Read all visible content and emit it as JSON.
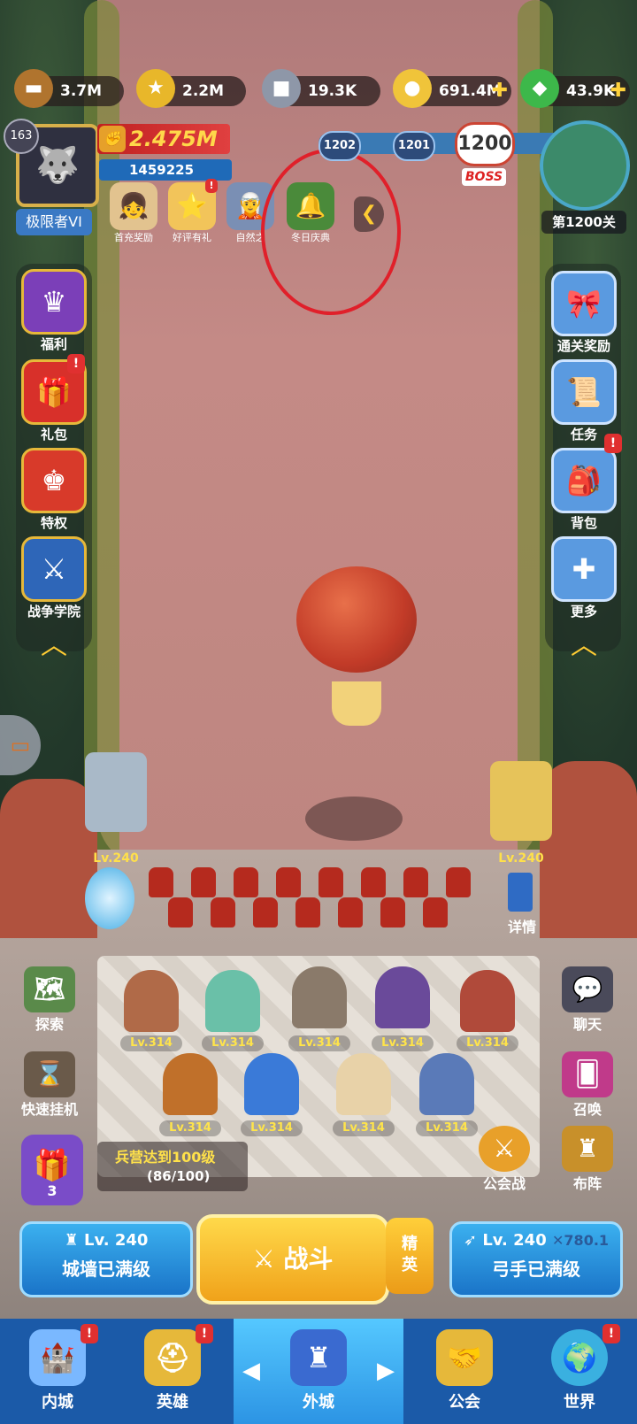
{
  "resources": [
    {
      "name": "wood",
      "icon": "wood-log-icon",
      "value": "3.7M",
      "has_plus": false
    },
    {
      "name": "medal",
      "icon": "star-medal-icon",
      "value": "2.2M",
      "has_plus": false
    },
    {
      "name": "iron",
      "icon": "iron-ingot-icon",
      "value": "19.3K",
      "has_plus": false
    },
    {
      "name": "gold",
      "icon": "gold-coin-icon",
      "value": "691.4M",
      "has_plus": true
    },
    {
      "name": "gem",
      "icon": "green-gem-icon",
      "value": "43.9K",
      "has_plus": true
    }
  ],
  "player": {
    "level": "163",
    "power": "2.475M",
    "id": "1459225",
    "rank": "极限者VI"
  },
  "events": [
    {
      "label": "首充奖励",
      "icon": "girl-portrait-icon"
    },
    {
      "label": "好评有礼",
      "icon": "star-card-icon",
      "badge": "!"
    },
    {
      "label": "自然之",
      "icon": "hero-portrait-icon"
    },
    {
      "label": "冬日庆典",
      "icon": "christmas-bell-icon"
    }
  ],
  "stages": {
    "prev2": "1202",
    "prev1": "1201",
    "current": "1200",
    "boss_label": "BOSS",
    "map_label": "第1200关"
  },
  "left_menu": [
    {
      "label": "福利",
      "icon": "crown-badge-icon",
      "badge": ""
    },
    {
      "label": "礼包",
      "icon": "gift-box-icon",
      "badge": "!"
    },
    {
      "label": "特权",
      "icon": "crown-shield-icon",
      "badge": ""
    },
    {
      "label": "战争学院",
      "icon": "crossed-swords-shield-icon",
      "badge": ""
    }
  ],
  "right_menu": [
    {
      "label": "通关奖励",
      "icon": "gift-icon",
      "badge": ""
    },
    {
      "label": "任务",
      "icon": "task-scroll-icon",
      "badge": "!"
    },
    {
      "label": "背包",
      "icon": "backpack-icon",
      "badge": ""
    },
    {
      "label": "更多",
      "icon": "plus-dpad-icon",
      "badge": ""
    }
  ],
  "towers": {
    "left_level": "Lv.240",
    "right_level": "Lv.240",
    "detail_label": "详情"
  },
  "heroes_row1": [
    "Lv.314",
    "Lv.314",
    "Lv.314",
    "Lv.314",
    "Lv.314"
  ],
  "heroes_row2": [
    "Lv.314",
    "Lv.314",
    "Lv.314",
    "Lv.314"
  ],
  "side_actions_left": [
    {
      "label": "探索",
      "icon": "map-sword-icon"
    },
    {
      "label": "快速挂机",
      "icon": "hourglass-icon"
    }
  ],
  "side_actions_right": [
    {
      "label": "聊天",
      "icon": "chat-bubble-icon"
    },
    {
      "label": "召唤",
      "icon": "cards-icon"
    }
  ],
  "barracks": {
    "title": "兵营达到100级",
    "progress_text": "(86/100)",
    "current": 86,
    "max": 100
  },
  "gift_count": "3",
  "guild_war": "公会战",
  "formation": "布阵",
  "actions": {
    "wall_level": "Lv. 240",
    "wall_status": "城墙已满级",
    "fight": "战斗",
    "elite": "精英",
    "archer_level": "Lv. 240",
    "archer_bonus": "780.1",
    "archer_status": "弓手已满级"
  },
  "nav": [
    {
      "label": "内城",
      "icon": "castle-icon",
      "badge": "!"
    },
    {
      "label": "英雄",
      "icon": "knight-helmet-icon",
      "badge": "!"
    },
    {
      "label": "外城",
      "icon": "castle-tower-icon",
      "badge": ""
    },
    {
      "label": "公会",
      "icon": "handshake-shield-icon",
      "badge": ""
    },
    {
      "label": "世界",
      "icon": "globe-icon",
      "badge": "!"
    }
  ],
  "colors": {
    "annotation_circle": "#e0202a",
    "accent_gold": "#ffd23c",
    "nav_blue": "#1b5aa8"
  }
}
